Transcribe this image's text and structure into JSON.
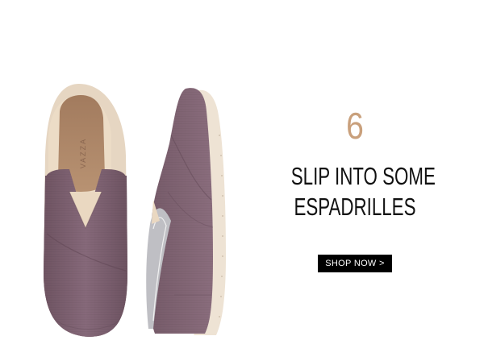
{
  "promo": {
    "number": "6",
    "headline_line1": "SLIP INTO SOME",
    "headline_line2": "ESPADRILLES",
    "button_label": "SHOP  NOW >"
  },
  "product_image": {
    "insole_text": "VAZZA"
  },
  "colors": {
    "accent_number": "#c9a07c",
    "shoe_canvas": "#7e6472",
    "button_bg": "#000000",
    "button_text": "#ffffff"
  }
}
